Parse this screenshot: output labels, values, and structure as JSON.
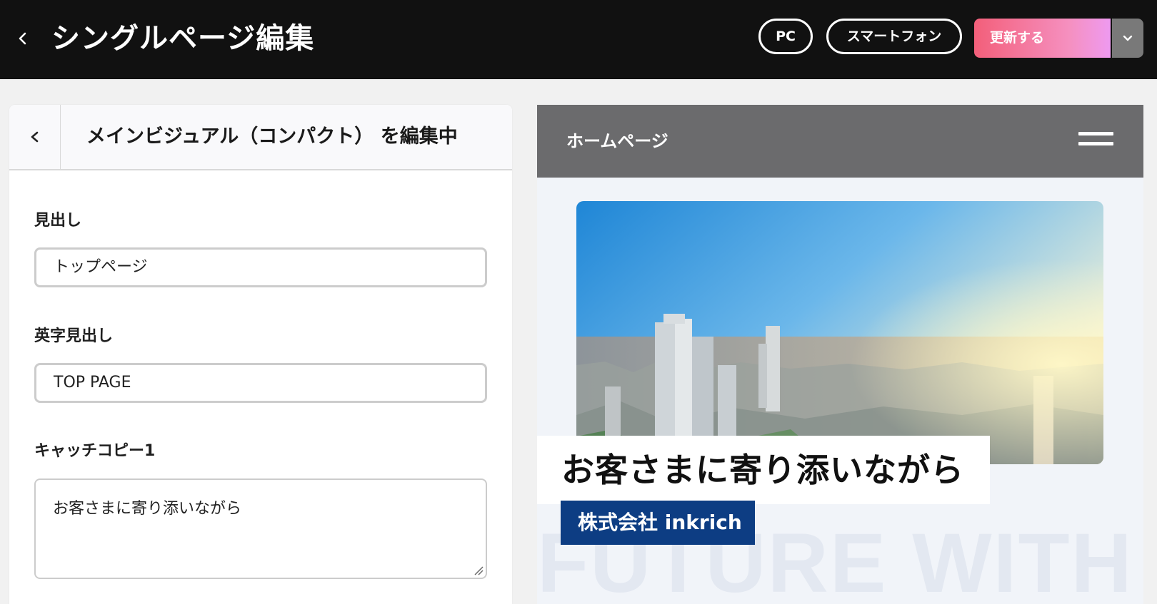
{
  "topbar": {
    "title": "シングルページ編集",
    "pc_label": "PC",
    "smartphone_label": "スマートフォン",
    "update_label": "更新する"
  },
  "panel": {
    "title": "メインビジュアル（コンパクト） を編集中",
    "fields": [
      {
        "label": "見出し",
        "value": "トップページ"
      },
      {
        "label": "英字見出し",
        "value": "TOP PAGE"
      },
      {
        "label": "キャッチコピー1",
        "value": "お客さまに寄り添いながら"
      }
    ]
  },
  "preview": {
    "header_title": "ホームページ",
    "catch_copy": "お客さまに寄り添いながら",
    "company": "株式会社 inkrich",
    "background_text": "FUTURE WITH YOU"
  },
  "colors": {
    "topbar_bg": "#111111",
    "update_gradient_start": "#f35f7a",
    "update_gradient_end": "#ee9af0",
    "preview_header_bg": "#6b6b6d",
    "company_bg": "#0d3d83"
  }
}
